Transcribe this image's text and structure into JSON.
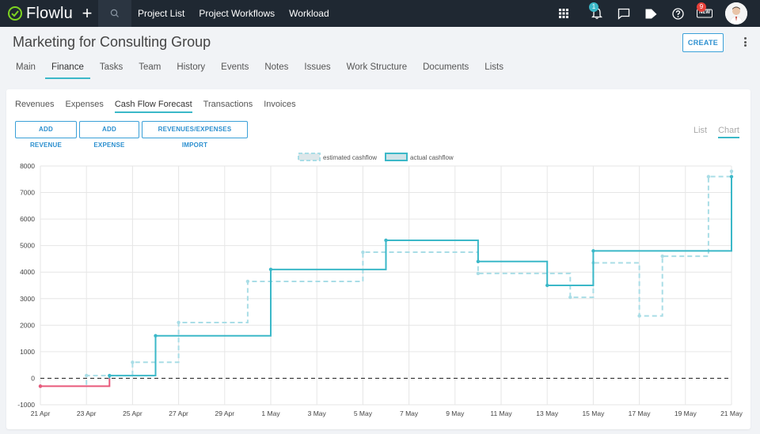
{
  "topbar": {
    "app_name": "Flowlu",
    "nav": [
      "Project List",
      "Project Workflows",
      "Workload"
    ],
    "notifications_badge": "1",
    "news_badge": "9",
    "news_label": "NEW"
  },
  "header": {
    "title": "Marketing for Consulting Group",
    "create_label": "CREATE"
  },
  "main_tabs": [
    "Main",
    "Finance",
    "Tasks",
    "Team",
    "History",
    "Events",
    "Notes",
    "Issues",
    "Work Structure",
    "Documents",
    "Lists"
  ],
  "main_tabs_active": 1,
  "sub_tabs": [
    "Revenues",
    "Expenses",
    "Cash Flow Forecast",
    "Transactions",
    "Invoices"
  ],
  "sub_tabs_active": 2,
  "actions": [
    "ADD REVENUE",
    "ADD EXPENSE",
    "REVENUES/EXPENSES IMPORT"
  ],
  "view_toggle": [
    "List",
    "Chart"
  ],
  "view_toggle_active": 1,
  "colors": {
    "accent": "#3bb8c8",
    "estimated": "#a9dde6",
    "actual": "#3bb8c8",
    "negative": "#e8587a",
    "topbar": "#1f2832"
  },
  "chart_data": {
    "type": "line",
    "step": true,
    "legend_position": "top",
    "x_ticks": [
      "21 Apr",
      "23 Apr",
      "25 Apr",
      "27 Apr",
      "29 Apr",
      "1 May",
      "3 May",
      "5 May",
      "7 May",
      "9 May",
      "11 May",
      "13 May",
      "15 May",
      "17 May",
      "19 May",
      "21 May"
    ],
    "y_ticks": [
      8000,
      7000,
      6000,
      5000,
      4000,
      3000,
      2000,
      1000,
      0,
      -1000
    ],
    "ylim": [
      -1000,
      8000
    ],
    "xlim": [
      "21 Apr",
      "21 May"
    ],
    "grid": true,
    "zero_line": "dashed",
    "series": [
      {
        "name": "estimated cashflow",
        "style": "dashed",
        "points": [
          [
            "21 Apr",
            -300
          ],
          [
            "23 Apr",
            100
          ],
          [
            "25 Apr",
            600
          ],
          [
            "27 Apr",
            2100
          ],
          [
            "30 Apr",
            3650
          ],
          [
            "5 May",
            4750
          ],
          [
            "10 May",
            3950
          ],
          [
            "14 May",
            3050
          ],
          [
            "15 May",
            4350
          ],
          [
            "17 May",
            2350
          ],
          [
            "18 May",
            4600
          ],
          [
            "20 May",
            7600
          ],
          [
            "21 May",
            7800
          ]
        ]
      },
      {
        "name": "actual cashflow",
        "style": "solid",
        "negative_color": "#e8587a",
        "points": [
          [
            "21 Apr",
            -300
          ],
          [
            "24 Apr",
            100
          ],
          [
            "26 Apr",
            1600
          ],
          [
            "1 May",
            4100
          ],
          [
            "6 May",
            5200
          ],
          [
            "10 May",
            4400
          ],
          [
            "13 May",
            3500
          ],
          [
            "15 May",
            4800
          ],
          [
            "21 May",
            7600
          ]
        ]
      }
    ]
  }
}
